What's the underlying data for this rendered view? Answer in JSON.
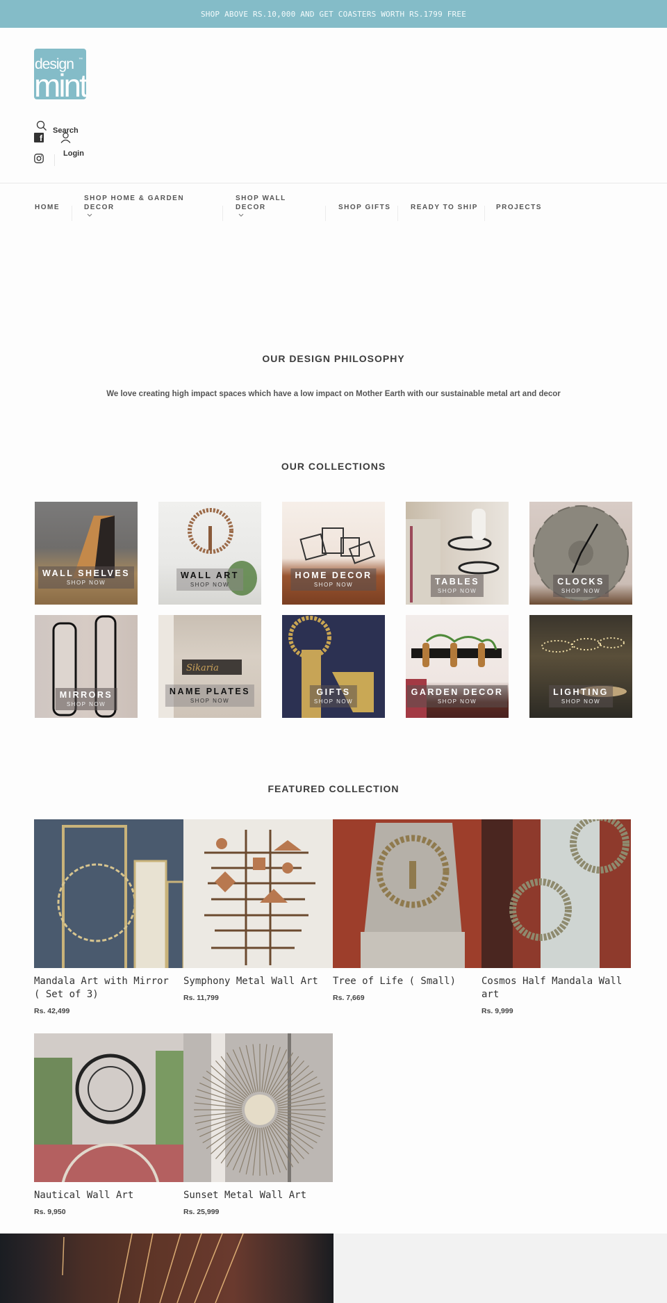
{
  "announcement": "SHOP ABOVE RS.10,000 AND GET COASTERS WORTH RS.1799 FREE",
  "brand": {
    "line1": "design",
    "line2": "mint",
    "tm": "™",
    "color": "#84bcc8"
  },
  "header": {
    "search_label": "Search",
    "login_label": "Login",
    "facebook_glyph": "f"
  },
  "nav": {
    "items": [
      {
        "label": "HOME",
        "has_dropdown": false
      },
      {
        "label": "SHOP HOME & GARDEN DECOR",
        "has_dropdown": true
      },
      {
        "label": "SHOP WALL DECOR",
        "has_dropdown": true
      },
      {
        "label": "SHOP GIFTS",
        "has_dropdown": false
      },
      {
        "label": "READY TO SHIP",
        "has_dropdown": false
      },
      {
        "label": "PROJECTS",
        "has_dropdown": false
      }
    ]
  },
  "philosophy": {
    "title": "OUR DESIGN PHILOSOPHY",
    "text": "We love creating high impact spaces which have a low impact on Mother Earth with our sustainable metal art and decor"
  },
  "collections": {
    "title": "OUR COLLECTIONS",
    "cta": "SHOP NOW",
    "items": [
      {
        "label": "WALL SHELVES"
      },
      {
        "label": "WALL ART"
      },
      {
        "label": "HOME DECOR"
      },
      {
        "label": "TABLES"
      },
      {
        "label": "CLOCKS"
      },
      {
        "label": "MIRRORS"
      },
      {
        "label": "NAME PLATES"
      },
      {
        "label": "GIFTS"
      },
      {
        "label": "GARDEN DECOR"
      },
      {
        "label": "LIGHTING"
      }
    ]
  },
  "featured": {
    "title": "FEATURED COLLECTION",
    "products": [
      {
        "name": "Mandala Art with Mirror ( Set of 3)",
        "price": "Rs. 42,499"
      },
      {
        "name": "Symphony Metal Wall Art",
        "price": "Rs. 11,799"
      },
      {
        "name": "Tree of Life ( Small)",
        "price": "Rs. 7,669"
      },
      {
        "name": "Cosmos Half Mandala Wall art",
        "price": "Rs. 9,999"
      },
      {
        "name": "Nautical Wall Art",
        "price": "Rs. 9,950"
      },
      {
        "name": "Sunset Metal Wall Art",
        "price": "Rs. 25,999"
      }
    ]
  }
}
